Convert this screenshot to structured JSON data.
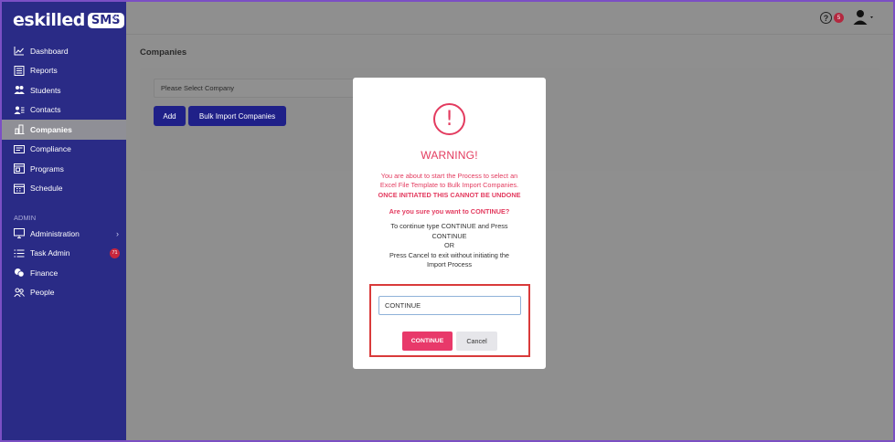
{
  "brand": {
    "name": "eskilled",
    "badge": "SMS",
    "collapse_glyph": "«"
  },
  "sidebar": {
    "items": [
      {
        "label": "Dashboard",
        "icon": "line-chart-icon"
      },
      {
        "label": "Reports",
        "icon": "report-table-icon"
      },
      {
        "label": "Students",
        "icon": "users-icon"
      },
      {
        "label": "Contacts",
        "icon": "contact-card-icon"
      },
      {
        "label": "Companies",
        "icon": "building-icon",
        "active": true
      },
      {
        "label": "Compliance",
        "icon": "id-card-icon"
      },
      {
        "label": "Programs",
        "icon": "window-icon"
      },
      {
        "label": "Schedule",
        "icon": "calendar-icon"
      }
    ],
    "section_label": "ADMIN",
    "admin_items": [
      {
        "label": "Administration",
        "icon": "monitor-icon",
        "chevron": "›"
      },
      {
        "label": "Task Admin",
        "icon": "list-icon",
        "badge": "71"
      },
      {
        "label": "Finance",
        "icon": "coins-icon"
      },
      {
        "label": "People",
        "icon": "people-outline-icon"
      }
    ]
  },
  "topbar": {
    "help_glyph": "?",
    "notification_count": "5"
  },
  "page": {
    "title": "Companies",
    "company_select": "Please Select Company",
    "add_label": "Add",
    "bulk_label": "Bulk Import Companies"
  },
  "modal": {
    "icon_glyph": "!",
    "title": "WARNING!",
    "message_line1": "You are about to start the Process to select an",
    "message_line2": "Excel File Template to Bulk Import Companies.",
    "message_strong": "ONCE INITIATED THIS CANNOT BE UNDONE",
    "question": "Are you sure you want to CONTINUE?",
    "instr_line1": "To continue type CONTINUE and Press",
    "instr_line2": "CONTINUE",
    "instr_line3": "OR",
    "instr_line4": "Press Cancel to exit without initiating the",
    "instr_line5": "Import Process",
    "input_value": "CONTINUE",
    "continue_label": "CONTINUE",
    "cancel_label": "Cancel"
  },
  "colors": {
    "sidebar_bg": "#2a2b86",
    "accent": "#e33b5f",
    "primary_button": "#1f2088",
    "highlight_border": "#d93a3a"
  }
}
